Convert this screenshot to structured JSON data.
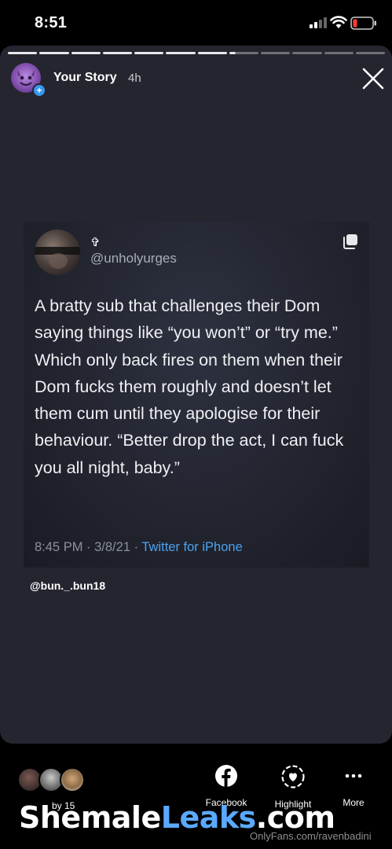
{
  "status_bar": {
    "time": "8:51"
  },
  "story": {
    "user": "Your Story",
    "age": "4h",
    "progress_segments": 12,
    "progress_done": 7,
    "mention": "@bun._.bun18"
  },
  "tweet": {
    "display_name": "✞",
    "handle": "@unholyurges",
    "text": "A bratty sub that challenges their Dom saying things like “you won’t” or “try me.” Which only back fires on them when their Dom fucks them roughly and doesn’t let them cum until they apologise for their behaviour. “Better drop the act, I can fuck you all night, baby.”",
    "timestamp": "8:45 PM · 3/8/21 · ",
    "source": "Twitter for iPhone"
  },
  "bottom_bar": {
    "viewers_label": "by 15",
    "actions": [
      {
        "label": "Facebook",
        "icon": "facebook-icon"
      },
      {
        "label": "Highlight",
        "icon": "highlight-heart-icon"
      },
      {
        "label": "More",
        "icon": "more-dots-icon"
      }
    ]
  },
  "watermark": {
    "part1": "Shemale",
    "part2": "Leaks",
    "part3": ".com",
    "credit": "OnlyFans.com/ravenbadini"
  },
  "colors": {
    "story_bg": "#24252f",
    "link_blue": "#4ca3f0",
    "badge_blue": "#3897f0",
    "battery_red": "#ff3b30"
  }
}
